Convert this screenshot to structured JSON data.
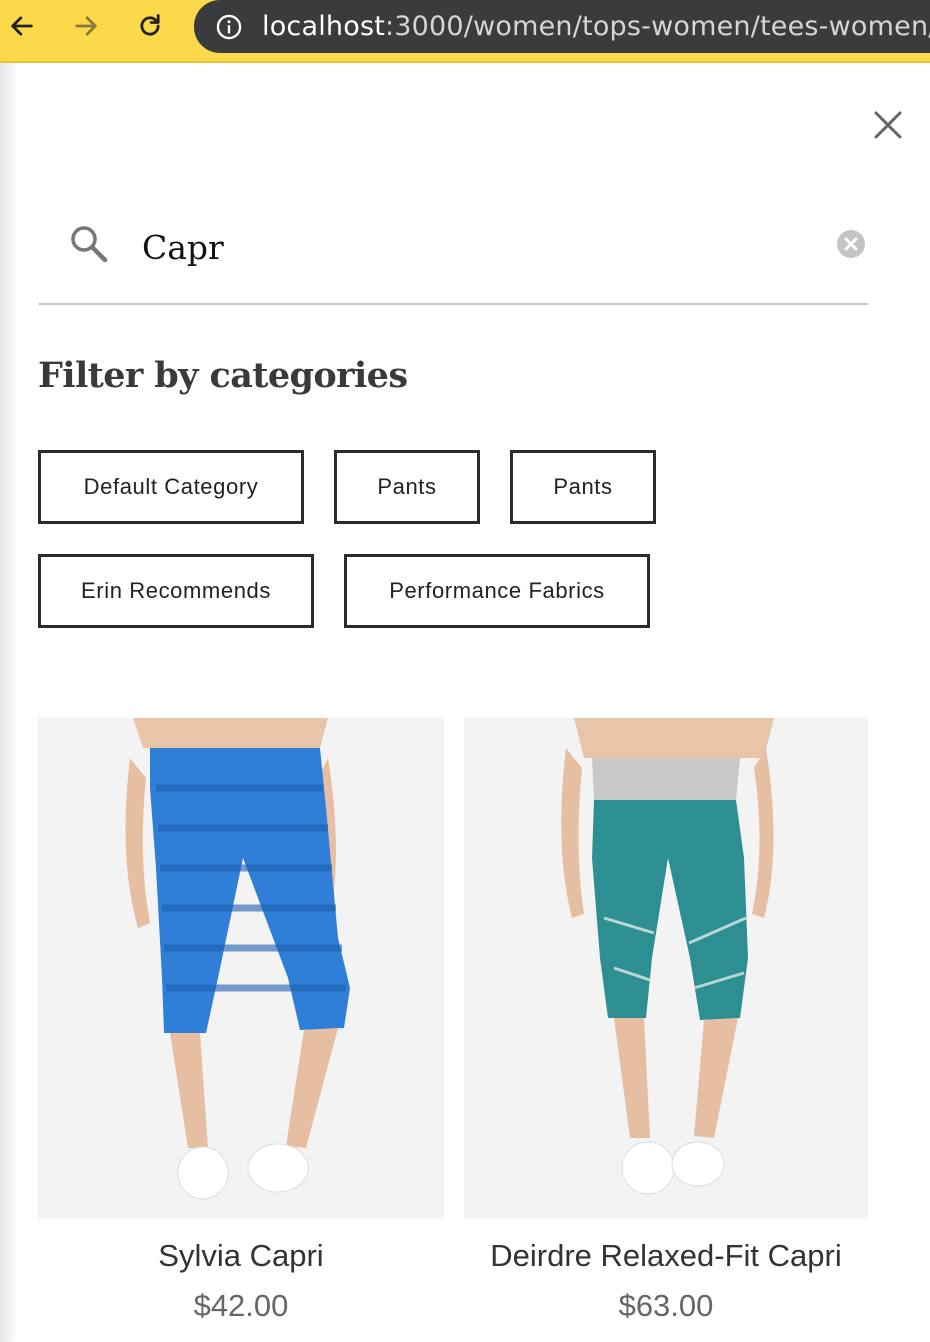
{
  "browser": {
    "url_host": "localhost",
    "url_path": ":3000/women/tops-women/tees-women/t",
    "back_icon": "arrow-left-icon",
    "forward_icon": "arrow-right-icon",
    "reload_icon": "reload-icon",
    "info_icon": "info-icon",
    "chrome_color": "#fbd94a",
    "urlbar_color": "#3a3b3d"
  },
  "search": {
    "value": "Capr",
    "search_icon": "magnifier-icon",
    "clear_icon": "clear-circle-icon",
    "close_icon": "close-x-icon"
  },
  "filters": {
    "title": "Filter by categories",
    "categories": [
      "Default Category",
      "Pants",
      "Pants",
      "Erin Recommends",
      "Performance Fabrics"
    ]
  },
  "products": [
    {
      "name": "Sylvia Capri",
      "price": "$42.00",
      "color": "#2f7fd8"
    },
    {
      "name": "Deirdre Relaxed-Fit Capri",
      "price": "$63.00",
      "color": "#2e8f93"
    }
  ]
}
